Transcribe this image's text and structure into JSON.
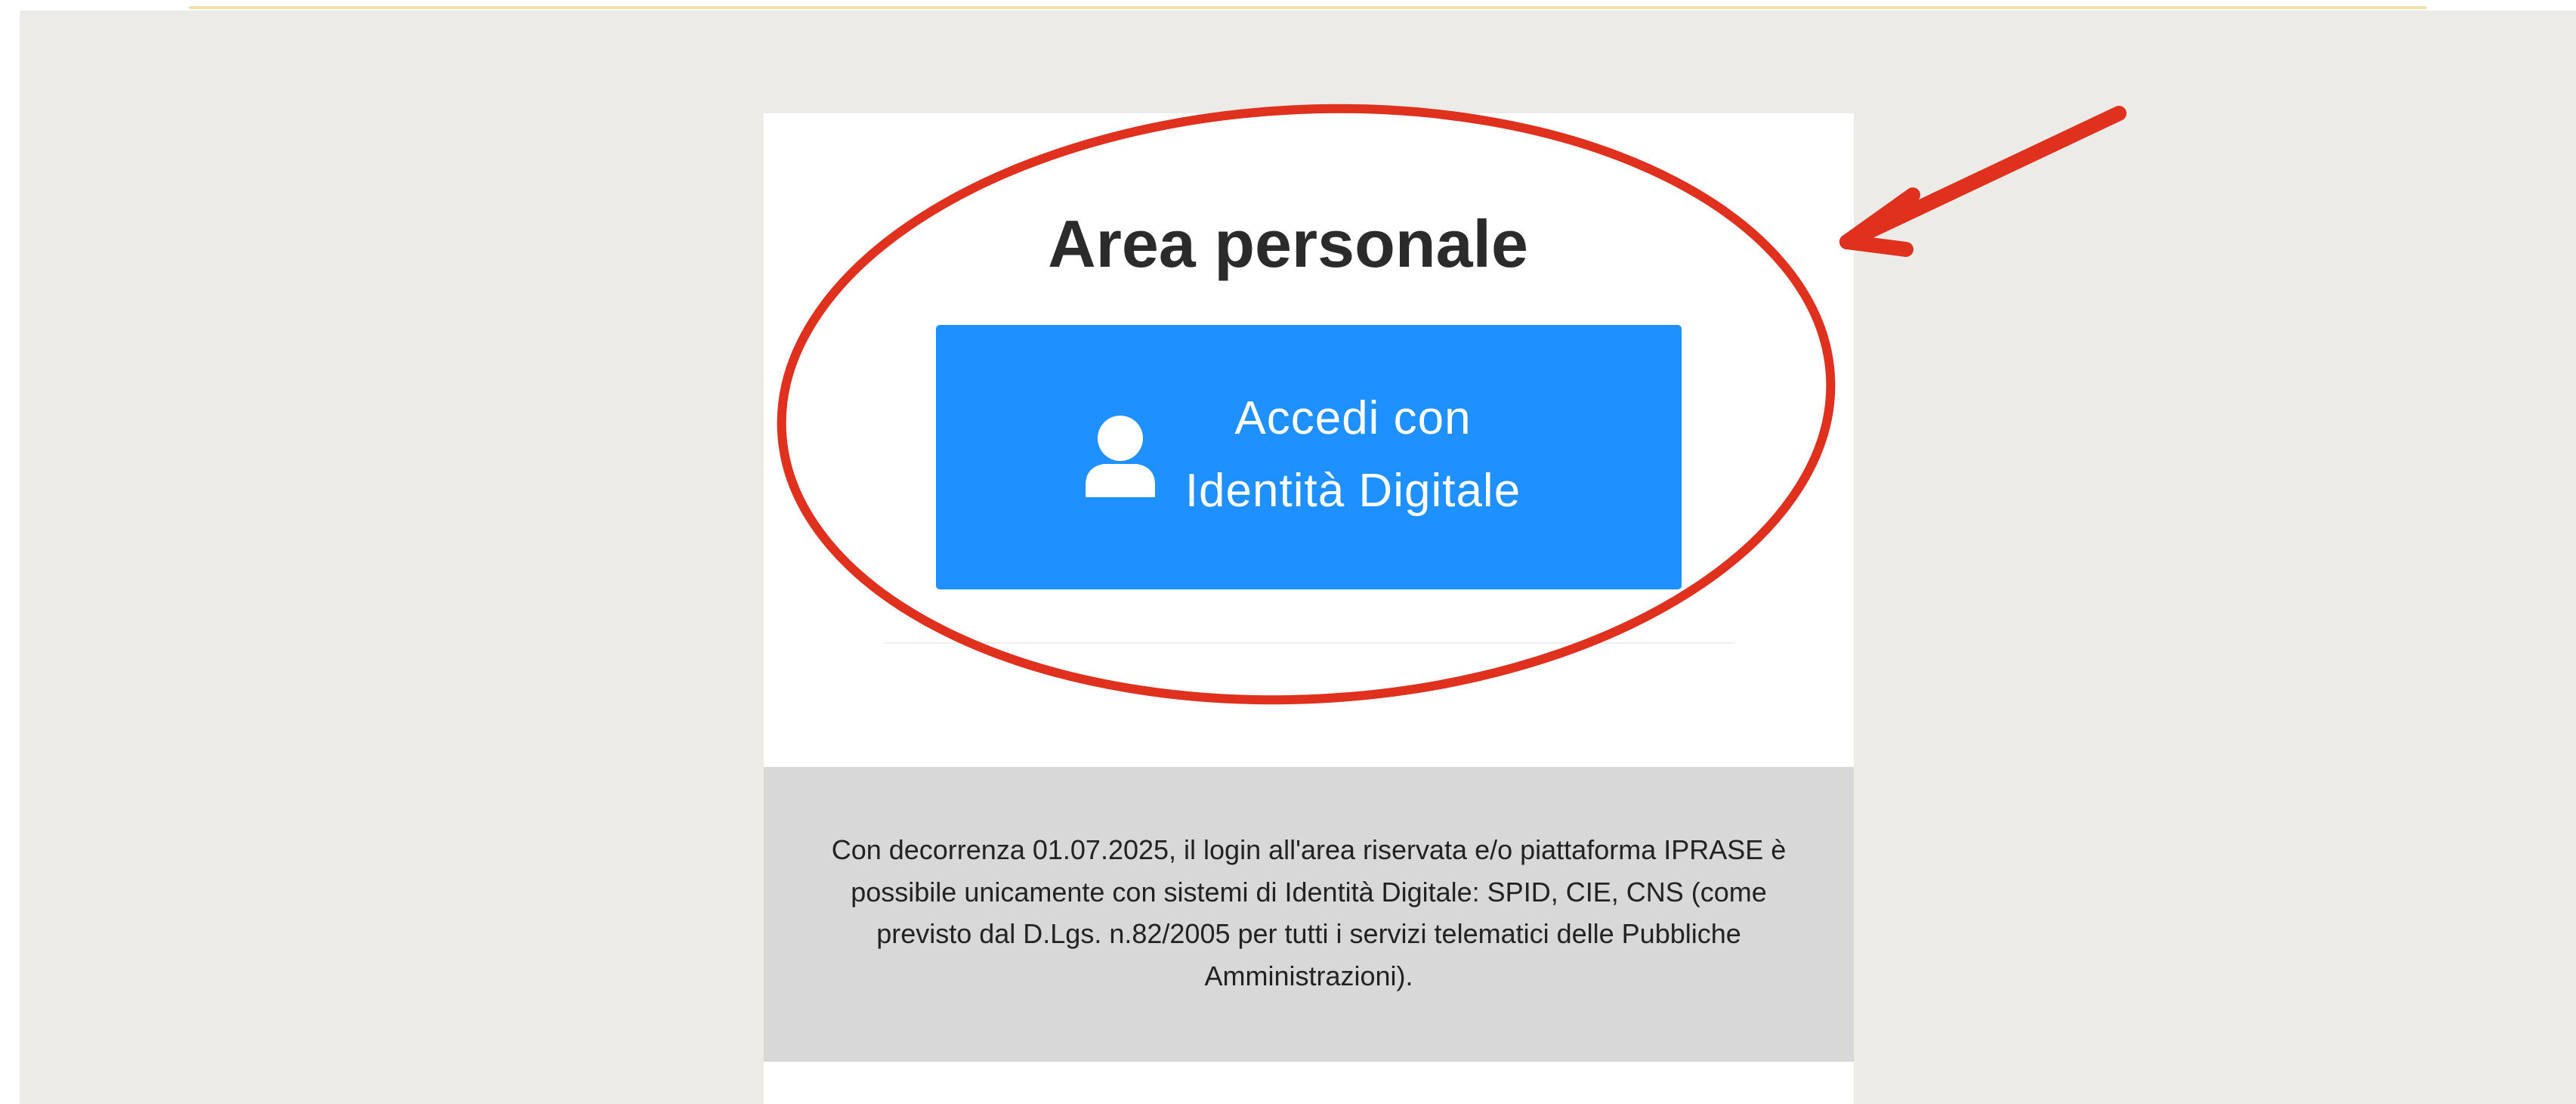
{
  "page": {
    "title": "Area personale"
  },
  "login": {
    "button_line1": "Accedi con",
    "button_line2": "Identità Digitale",
    "icon": "user-icon"
  },
  "notice": {
    "text": "Con decorrenza 01.07.2025, il login all'area riservata e/o piattaforma IPRASE è possibile unicamente con sistemi di Identità Digitale: SPID, CIE, CNS (come previsto dal D.Lgs. n.82/2005 per tutti i servizi telematici delle Pubbliche Amministrazioni)."
  },
  "annotation": {
    "shapes": [
      "ellipse-highlight",
      "arrow"
    ],
    "color": "#e0301e"
  },
  "colors": {
    "page_background": "#ecebe7",
    "card_background": "#ffffff",
    "button_background": "#1e90ff",
    "notice_background": "#d8d8d8",
    "top_accent": "#f3dfae",
    "title_text": "#2b2b2b"
  }
}
